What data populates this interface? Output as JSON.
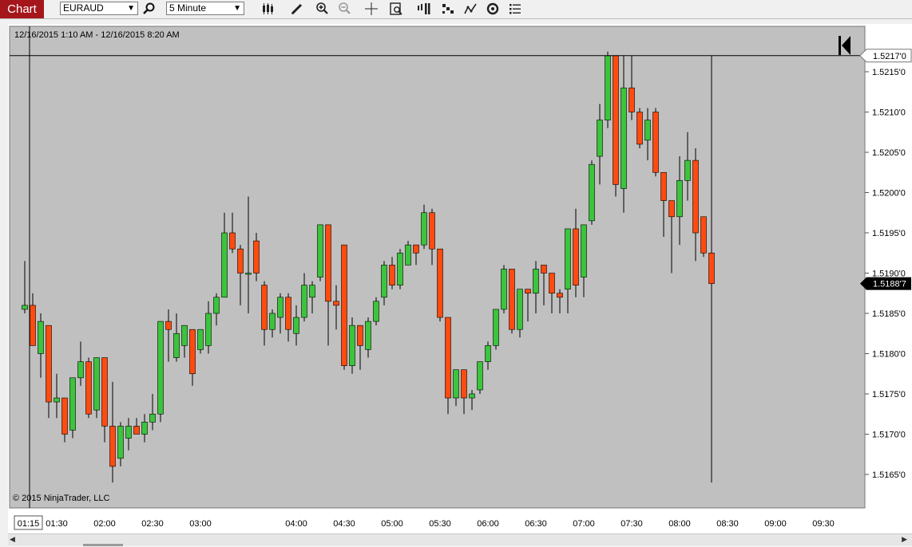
{
  "toolbar": {
    "tab_label": "Chart",
    "instrument": "EURAUD",
    "interval": "5 Minute",
    "icons": [
      "search-icon",
      "bar-type-icon",
      "draw-pencil-icon",
      "zoom-in-icon",
      "zoom-out-icon",
      "crosshair-icon",
      "data-box-icon",
      "strategies-icon",
      "indicators-icon",
      "trend-icon",
      "refresh-icon",
      "properties-icon"
    ]
  },
  "date_range": "12/16/2015 1:10 AM - 12/16/2015 8:20 AM",
  "copyright": "© 2015 NinjaTrader, LLC",
  "colors": {
    "up": "#3cc43c",
    "down": "#ff4b10",
    "plot_bg": "#c0c0c0",
    "brand": "#a5161b"
  },
  "chart_data": {
    "type": "candlestick",
    "ylim": [
      1.51625,
      1.52215
    ],
    "y_ticks": [
      1.5215,
      1.521,
      1.5205,
      1.52,
      1.5195,
      1.519,
      1.5185,
      1.518,
      1.5175,
      1.517,
      1.5165
    ],
    "y_tick_labels": [
      "1.5215'0",
      "1.5210'0",
      "1.5205'0",
      "1.5200'0",
      "1.5195'0",
      "1.5190'0",
      "1.5185'0",
      "1.5180'0",
      "1.5175'0",
      "1.5170'0",
      "1.5165'0"
    ],
    "x_tick_labels": [
      "01:30",
      "02:00",
      "02:30",
      "03:00",
      "04:00",
      "04:30",
      "05:00",
      "05:30",
      "06:00",
      "06:30",
      "07:00",
      "07:30",
      "08:00",
      "08:30",
      "09:00",
      "09:30"
    ],
    "x_tick_times": [
      "01:30",
      "02:00",
      "02:30",
      "03:00",
      "04:00",
      "04:30",
      "05:00",
      "05:30",
      "06:00",
      "06:30",
      "07:00",
      "07:30",
      "08:00",
      "08:30",
      "09:00",
      "09:30"
    ],
    "crosshair_time_label": "01:15",
    "crosshair_price": 1.5217,
    "crosshair_price_label": "1.5217'0",
    "last_price": 1.51887,
    "last_price_label": "1.5188'7",
    "candles": [
      {
        "t": "01:10",
        "o": 1.51855,
        "h": 1.51915,
        "l": 1.5185,
        "c": 1.5186
      },
      {
        "t": "01:15",
        "o": 1.5186,
        "h": 1.51875,
        "l": 1.5181,
        "c": 1.5181
      },
      {
        "t": "01:20",
        "o": 1.518,
        "h": 1.5185,
        "l": 1.5177,
        "c": 1.5184
      },
      {
        "t": "01:25",
        "o": 1.51835,
        "h": 1.51835,
        "l": 1.5172,
        "c": 1.5174
      },
      {
        "t": "01:30",
        "o": 1.5174,
        "h": 1.51775,
        "l": 1.5172,
        "c": 1.51745
      },
      {
        "t": "01:35",
        "o": 1.51745,
        "h": 1.51745,
        "l": 1.5169,
        "c": 1.517
      },
      {
        "t": "01:40",
        "o": 1.51705,
        "h": 1.5177,
        "l": 1.51695,
        "c": 1.5177
      },
      {
        "t": "01:45",
        "o": 1.5177,
        "h": 1.51815,
        "l": 1.5176,
        "c": 1.5179
      },
      {
        "t": "01:50",
        "o": 1.5179,
        "h": 1.51795,
        "l": 1.5172,
        "c": 1.51725
      },
      {
        "t": "01:55",
        "o": 1.5173,
        "h": 1.51795,
        "l": 1.5172,
        "c": 1.51795
      },
      {
        "t": "02:00",
        "o": 1.51795,
        "h": 1.51795,
        "l": 1.5169,
        "c": 1.5171
      },
      {
        "t": "02:05",
        "o": 1.5171,
        "h": 1.51765,
        "l": 1.5164,
        "c": 1.5166
      },
      {
        "t": "02:10",
        "o": 1.5167,
        "h": 1.51715,
        "l": 1.5166,
        "c": 1.5171
      },
      {
        "t": "02:15",
        "o": 1.51695,
        "h": 1.5172,
        "l": 1.5168,
        "c": 1.5171
      },
      {
        "t": "02:20",
        "o": 1.5171,
        "h": 1.5172,
        "l": 1.517,
        "c": 1.517
      },
      {
        "t": "02:25",
        "o": 1.517,
        "h": 1.51725,
        "l": 1.5169,
        "c": 1.51715
      },
      {
        "t": "02:30",
        "o": 1.51715,
        "h": 1.5175,
        "l": 1.51705,
        "c": 1.51725
      },
      {
        "t": "02:35",
        "o": 1.51725,
        "h": 1.5184,
        "l": 1.51715,
        "c": 1.5184
      },
      {
        "t": "02:40",
        "o": 1.5184,
        "h": 1.51855,
        "l": 1.5179,
        "c": 1.5183
      },
      {
        "t": "02:45",
        "o": 1.51795,
        "h": 1.5185,
        "l": 1.5179,
        "c": 1.51825
      },
      {
        "t": "02:50",
        "o": 1.5181,
        "h": 1.51835,
        "l": 1.51795,
        "c": 1.51835
      },
      {
        "t": "02:55",
        "o": 1.5183,
        "h": 1.5183,
        "l": 1.5176,
        "c": 1.51775
      },
      {
        "t": "03:00",
        "o": 1.51805,
        "h": 1.5183,
        "l": 1.518,
        "c": 1.5183
      },
      {
        "t": "03:05",
        "o": 1.5181,
        "h": 1.51865,
        "l": 1.518,
        "c": 1.5185
      },
      {
        "t": "03:10",
        "o": 1.5185,
        "h": 1.51875,
        "l": 1.51835,
        "c": 1.5187
      },
      {
        "t": "03:15",
        "o": 1.5187,
        "h": 1.51975,
        "l": 1.5187,
        "c": 1.5195
      },
      {
        "t": "03:20",
        "o": 1.5195,
        "h": 1.51975,
        "l": 1.51925,
        "c": 1.5193
      },
      {
        "t": "03:25",
        "o": 1.5193,
        "h": 1.51935,
        "l": 1.5186,
        "c": 1.519
      },
      {
        "t": "03:30",
        "o": 1.519,
        "h": 1.51995,
        "l": 1.5185,
        "c": 1.519
      },
      {
        "t": "03:35",
        "o": 1.5194,
        "h": 1.5195,
        "l": 1.5189,
        "c": 1.519
      },
      {
        "t": "03:40",
        "o": 1.51885,
        "h": 1.5189,
        "l": 1.5181,
        "c": 1.5183
      },
      {
        "t": "03:45",
        "o": 1.5183,
        "h": 1.51855,
        "l": 1.5182,
        "c": 1.5185
      },
      {
        "t": "03:50",
        "o": 1.51845,
        "h": 1.51875,
        "l": 1.51825,
        "c": 1.5187
      },
      {
        "t": "03:55",
        "o": 1.5187,
        "h": 1.51875,
        "l": 1.51815,
        "c": 1.5183
      },
      {
        "t": "04:00",
        "o": 1.51825,
        "h": 1.5186,
        "l": 1.5181,
        "c": 1.51845
      },
      {
        "t": "04:05",
        "o": 1.51845,
        "h": 1.519,
        "l": 1.5184,
        "c": 1.51885
      },
      {
        "t": "04:10",
        "o": 1.5187,
        "h": 1.5189,
        "l": 1.5185,
        "c": 1.51885
      },
      {
        "t": "04:15",
        "o": 1.51895,
        "h": 1.5196,
        "l": 1.5189,
        "c": 1.5196
      },
      {
        "t": "04:20",
        "o": 1.5196,
        "h": 1.5196,
        "l": 1.5181,
        "c": 1.51865
      },
      {
        "t": "04:25",
        "o": 1.51865,
        "h": 1.51885,
        "l": 1.5183,
        "c": 1.5186
      },
      {
        "t": "04:30",
        "o": 1.51935,
        "h": 1.51935,
        "l": 1.5178,
        "c": 1.51785
      },
      {
        "t": "04:35",
        "o": 1.51785,
        "h": 1.51845,
        "l": 1.51775,
        "c": 1.51835
      },
      {
        "t": "04:40",
        "o": 1.51835,
        "h": 1.51835,
        "l": 1.5178,
        "c": 1.5181
      },
      {
        "t": "04:45",
        "o": 1.51805,
        "h": 1.51845,
        "l": 1.51795,
        "c": 1.5184
      },
      {
        "t": "04:50",
        "o": 1.5184,
        "h": 1.5187,
        "l": 1.51835,
        "c": 1.51865
      },
      {
        "t": "04:55",
        "o": 1.5187,
        "h": 1.51915,
        "l": 1.5186,
        "c": 1.5191
      },
      {
        "t": "05:00",
        "o": 1.5191,
        "h": 1.5192,
        "l": 1.5188,
        "c": 1.51885
      },
      {
        "t": "05:05",
        "o": 1.51885,
        "h": 1.5193,
        "l": 1.5188,
        "c": 1.51925
      },
      {
        "t": "05:10",
        "o": 1.5191,
        "h": 1.5194,
        "l": 1.5191,
        "c": 1.51935
      },
      {
        "t": "05:15",
        "o": 1.51935,
        "h": 1.51935,
        "l": 1.5191,
        "c": 1.51925
      },
      {
        "t": "05:20",
        "o": 1.51935,
        "h": 1.51985,
        "l": 1.5193,
        "c": 1.51975
      },
      {
        "t": "05:25",
        "o": 1.51975,
        "h": 1.5198,
        "l": 1.5191,
        "c": 1.5193
      },
      {
        "t": "05:30",
        "o": 1.5193,
        "h": 1.5193,
        "l": 1.5184,
        "c": 1.51845
      },
      {
        "t": "05:35",
        "o": 1.51845,
        "h": 1.51845,
        "l": 1.51725,
        "c": 1.51745
      },
      {
        "t": "05:40",
        "o": 1.51745,
        "h": 1.5178,
        "l": 1.51735,
        "c": 1.5178
      },
      {
        "t": "05:45",
        "o": 1.5178,
        "h": 1.5178,
        "l": 1.51725,
        "c": 1.51745
      },
      {
        "t": "05:50",
        "o": 1.51745,
        "h": 1.51755,
        "l": 1.5173,
        "c": 1.5175
      },
      {
        "t": "05:55",
        "o": 1.51755,
        "h": 1.5179,
        "l": 1.5175,
        "c": 1.5179
      },
      {
        "t": "06:00",
        "o": 1.5179,
        "h": 1.51815,
        "l": 1.5178,
        "c": 1.5181
      },
      {
        "t": "06:05",
        "o": 1.5181,
        "h": 1.51855,
        "l": 1.51805,
        "c": 1.51855
      },
      {
        "t": "06:10",
        "o": 1.51855,
        "h": 1.5191,
        "l": 1.5185,
        "c": 1.51905
      },
      {
        "t": "06:15",
        "o": 1.51905,
        "h": 1.51905,
        "l": 1.51825,
        "c": 1.5183
      },
      {
        "t": "06:20",
        "o": 1.5183,
        "h": 1.5188,
        "l": 1.5182,
        "c": 1.5188
      },
      {
        "t": "06:25",
        "o": 1.5188,
        "h": 1.51875,
        "l": 1.5184,
        "c": 1.51875
      },
      {
        "t": "06:30",
        "o": 1.51875,
        "h": 1.51915,
        "l": 1.5185,
        "c": 1.51905
      },
      {
        "t": "06:35",
        "o": 1.5191,
        "h": 1.5191,
        "l": 1.5186,
        "c": 1.519
      },
      {
        "t": "06:40",
        "o": 1.519,
        "h": 1.519,
        "l": 1.5185,
        "c": 1.51875
      },
      {
        "t": "06:45",
        "o": 1.51875,
        "h": 1.5188,
        "l": 1.5185,
        "c": 1.5187
      },
      {
        "t": "06:50",
        "o": 1.5188,
        "h": 1.51955,
        "l": 1.5185,
        "c": 1.51955
      },
      {
        "t": "06:55",
        "o": 1.51955,
        "h": 1.5198,
        "l": 1.5187,
        "c": 1.51885
      },
      {
        "t": "07:00",
        "o": 1.51895,
        "h": 1.5196,
        "l": 1.5187,
        "c": 1.5196
      },
      {
        "t": "07:05",
        "o": 1.51965,
        "h": 1.5204,
        "l": 1.5196,
        "c": 1.52035
      },
      {
        "t": "07:10",
        "o": 1.52045,
        "h": 1.5211,
        "l": 1.5201,
        "c": 1.5209
      },
      {
        "t": "07:15",
        "o": 1.5209,
        "h": 1.52175,
        "l": 1.5208,
        "c": 1.5217
      },
      {
        "t": "07:20",
        "o": 1.5217,
        "h": 1.5217,
        "l": 1.51995,
        "c": 1.5201
      },
      {
        "t": "07:25",
        "o": 1.52005,
        "h": 1.5217,
        "l": 1.51975,
        "c": 1.5213
      },
      {
        "t": "07:30",
        "o": 1.5213,
        "h": 1.5217,
        "l": 1.5209,
        "c": 1.521
      },
      {
        "t": "07:35",
        "o": 1.521,
        "h": 1.52105,
        "l": 1.52055,
        "c": 1.5206
      },
      {
        "t": "07:40",
        "o": 1.52065,
        "h": 1.52105,
        "l": 1.5204,
        "c": 1.5209
      },
      {
        "t": "07:45",
        "o": 1.521,
        "h": 1.52105,
        "l": 1.5202,
        "c": 1.52025
      },
      {
        "t": "07:50",
        "o": 1.52025,
        "h": 1.52025,
        "l": 1.51945,
        "c": 1.5199
      },
      {
        "t": "07:55",
        "o": 1.5199,
        "h": 1.51975,
        "l": 1.519,
        "c": 1.5197
      },
      {
        "t": "08:00",
        "o": 1.5197,
        "h": 1.52045,
        "l": 1.51935,
        "c": 1.52015
      },
      {
        "t": "08:05",
        "o": 1.52015,
        "h": 1.52075,
        "l": 1.5199,
        "c": 1.5204
      },
      {
        "t": "08:10",
        "o": 1.5204,
        "h": 1.52055,
        "l": 1.51915,
        "c": 1.5195
      },
      {
        "t": "08:15",
        "o": 1.5197,
        "h": 1.51965,
        "l": 1.5192,
        "c": 1.51925
      },
      {
        "t": "08:20",
        "o": 1.51925,
        "h": 1.5217,
        "l": 1.5164,
        "c": 1.51887
      }
    ]
  }
}
